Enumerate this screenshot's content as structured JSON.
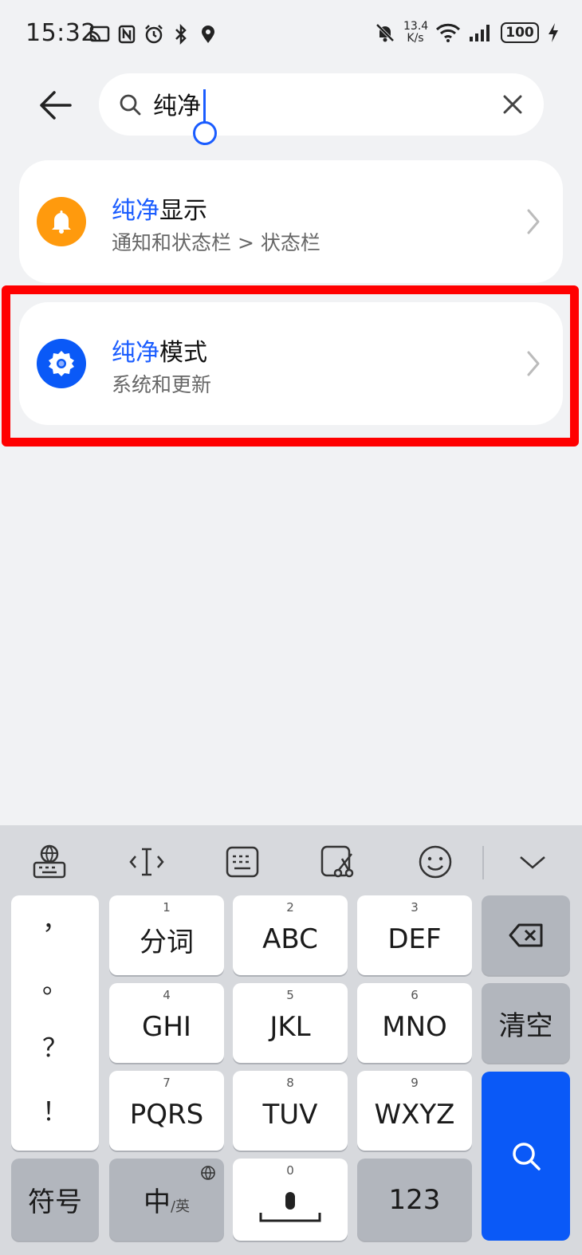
{
  "status_bar": {
    "time": "15:32",
    "net_speed_value": "13.4",
    "net_speed_unit": "K/s",
    "battery": "100",
    "icons_left": [
      "cast-icon",
      "nfc-icon",
      "alarm-icon",
      "bluetooth-icon",
      "location-icon"
    ],
    "icons_right": [
      "mute-icon",
      "wifi-icon",
      "signal-icon",
      "battery-icon",
      "charging-icon"
    ]
  },
  "search": {
    "query": "纯净"
  },
  "results": [
    {
      "title_highlight": "纯净",
      "title_rest": "显示",
      "subtitle": "通知和状态栏 > 状态栏",
      "icon": "bell-icon",
      "icon_color": "#ff9a0d"
    },
    {
      "title_highlight": "纯净",
      "title_rest": "模式",
      "subtitle": "系统和更新",
      "icon": "gear-icon",
      "icon_color": "#0a59f7"
    }
  ],
  "keyboard": {
    "toolbar": [
      "keyboard-switch-icon",
      "cursor-icon",
      "keyboard-layout-icon",
      "clipboard-icon",
      "emoji-icon",
      "collapse-icon"
    ],
    "punctuation": [
      "，",
      "。",
      "？",
      "！"
    ],
    "rows": [
      [
        {
          "num": "1",
          "label": "分词"
        },
        {
          "num": "2",
          "label": "ABC"
        },
        {
          "num": "3",
          "label": "DEF"
        }
      ],
      [
        {
          "num": "4",
          "label": "GHI"
        },
        {
          "num": "5",
          "label": "JKL"
        },
        {
          "num": "6",
          "label": "MNO"
        }
      ],
      [
        {
          "num": "7",
          "label": "PQRS"
        },
        {
          "num": "8",
          "label": "TUV"
        },
        {
          "num": "9",
          "label": "WXYZ"
        }
      ]
    ],
    "clear_label": "清空",
    "symbols_label": "符号",
    "lang_main": "中",
    "lang_sub": "/英",
    "space_num": "0",
    "numbers_label": "123"
  },
  "colors": {
    "accent": "#1a5cff",
    "highlight_frame": "#ff0000",
    "search_key": "#0a59f7"
  }
}
